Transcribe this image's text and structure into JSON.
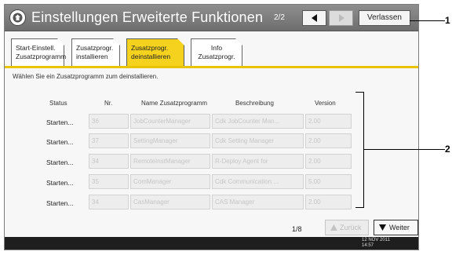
{
  "title_bar": {
    "title": "Einstellungen Erweiterte Funktionen",
    "page_indicator": "2/2",
    "exit_label": "Verlassen"
  },
  "tabs": [
    {
      "line1": "Start-Einstell.",
      "line2": "Zusatzprogramm",
      "active": false
    },
    {
      "line1": "Zusatzprogr.",
      "line2": "installieren",
      "active": false
    },
    {
      "line1": "Zusatzprogr.",
      "line2": "deinstallieren",
      "active": true
    },
    {
      "line1": "Info",
      "line2": "Zusatzprogr.",
      "active": false
    }
  ],
  "instruction": "Wählen Sie ein Zusatzprogramm zum deinstallieren.",
  "table": {
    "headers": {
      "status": "Status",
      "number": "Nr.",
      "name": "Name Zusatzprogramm",
      "description": "Beschreibung",
      "version": "Version"
    },
    "rows": [
      {
        "status": "Starten...",
        "number": "36",
        "name": "JobCounterManager",
        "description": "Cdk JobCounter Man...",
        "version": "2.00"
      },
      {
        "status": "Starten...",
        "number": "37",
        "name": "SettingManager",
        "description": "Cdk Setting Manager",
        "version": "2.00"
      },
      {
        "status": "Starten...",
        "number": "34",
        "name": "RemoteInstManager",
        "description": "R-Deploy Agent for",
        "version": "2.00"
      },
      {
        "status": "Starten...",
        "number": "35",
        "name": "ComManager",
        "description": "Cdk Communication ...",
        "version": "5.00"
      },
      {
        "status": "Starten...",
        "number": "34",
        "name": "CasManager",
        "description": "CAS Manager",
        "version": "2.00"
      }
    ]
  },
  "pagination": {
    "page": "1/8",
    "back_label": "Zurück",
    "next_label": "Weiter"
  },
  "status_bar": {
    "date": "12 NOV 2011",
    "time": "14:57"
  },
  "callouts": {
    "one": "1",
    "two": "2"
  },
  "colors": {
    "tab_active": "#f5d21e",
    "tab_underline": "#e8c300",
    "titlebar": "#7e7e7e",
    "statusbar": "#1e1e1e"
  }
}
